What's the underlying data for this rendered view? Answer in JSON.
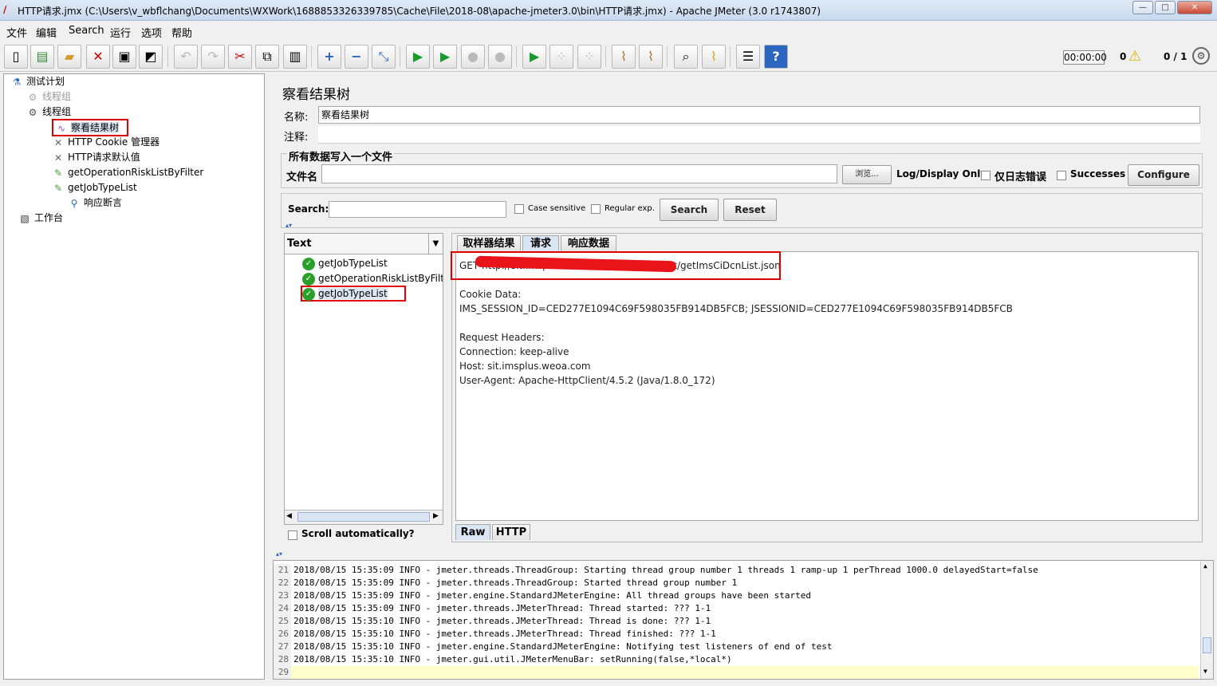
{
  "window": {
    "title": "HTTP请求.jmx (C:\\Users\\v_wbflchang\\Documents\\WXWork\\1688853326339785\\Cache\\File\\2018-08\\apache-jmeter3.0\\bin\\HTTP请求.jmx) - Apache JMeter (3.0 r1743807)",
    "min": "—",
    "max": "□",
    "close": "✕"
  },
  "menu": [
    "文件",
    "编辑",
    "Search",
    "运行",
    "选项",
    "帮助"
  ],
  "toolbar": {
    "timer": "00:00:00",
    "warnings": "0",
    "threads": "0 / 1"
  },
  "tree": {
    "items": [
      {
        "label": "测试计划",
        "icon": "test-plan-icon"
      },
      {
        "label": "线程组",
        "icon": "gear-icon"
      },
      {
        "label": "线程组",
        "icon": "gear-icon"
      },
      {
        "label": "察看结果树",
        "icon": "chart-icon"
      },
      {
        "label": "HTTP Cookie 管理器",
        "icon": "wrench-icon"
      },
      {
        "label": "HTTP请求默认值",
        "icon": "wrench-icon"
      },
      {
        "label": "getOperationRiskListByFilter",
        "icon": "pencil-icon"
      },
      {
        "label": "getJobTypeList",
        "icon": "pencil-icon"
      },
      {
        "label": "响应断言",
        "icon": "magnifier-icon"
      },
      {
        "label": "工作台",
        "icon": "workbench-icon"
      }
    ]
  },
  "panel": {
    "title": "察看结果树",
    "name_label": "名称:",
    "name_value": "察看结果树",
    "comment_label": "注释:",
    "comment_value": "",
    "file_group": "所有数据写入一个文件",
    "file_label": "文件名",
    "file_value": "",
    "browse": "浏览...",
    "log_display": "Log/Display Only:",
    "errors_only": "仅日志错误",
    "successes": "Successes",
    "configure": "Configure",
    "search_label": "Search:",
    "search_value": "",
    "case_sensitive": "Case sensitive",
    "regular_exp": "Regular exp.",
    "search_btn": "Search",
    "reset_btn": "Reset",
    "renderer": "Text",
    "results": [
      "getJobTypeList",
      "getOperationRiskListByFilter",
      "getJobTypeList"
    ],
    "scroll_auto": "Scroll automatically?",
    "tabs": [
      "取样器结果",
      "请求",
      "响应数据"
    ],
    "request_lines": [
      "GET http://sit.imsplus.weoa.com/ims_ci/ci_list/getImsCiDcnList.json",
      "",
      "Cookie Data:",
      "IMS_SESSION_ID=CED277E1094C69F598035FB914DB5FCB; JSESSIONID=CED277E1094C69F598035FB914DB5FCB",
      "",
      "Request Headers:",
      "Connection: keep-alive",
      "Host: sit.imsplus.weoa.com",
      "User-Agent: Apache-HttpClient/4.5.2 (Java/1.8.0_172)"
    ],
    "bottom_tabs": [
      "Raw",
      "HTTP"
    ]
  },
  "log": [
    {
      "n": "21",
      "t": "2018/08/15 15:35:09 INFO  - jmeter.threads.ThreadGroup: Starting thread group number 1 threads 1 ramp-up 1 perThread 1000.0 delayedStart=false"
    },
    {
      "n": "22",
      "t": "2018/08/15 15:35:09 INFO  - jmeter.threads.ThreadGroup: Started thread group number 1"
    },
    {
      "n": "23",
      "t": "2018/08/15 15:35:09 INFO  - jmeter.engine.StandardJMeterEngine: All thread groups have been started"
    },
    {
      "n": "24",
      "t": "2018/08/15 15:35:09 INFO  - jmeter.threads.JMeterThread: Thread started: ??? 1-1"
    },
    {
      "n": "25",
      "t": "2018/08/15 15:35:10 INFO  - jmeter.threads.JMeterThread: Thread is done: ??? 1-1"
    },
    {
      "n": "26",
      "t": "2018/08/15 15:35:10 INFO  - jmeter.threads.JMeterThread: Thread finished: ??? 1-1"
    },
    {
      "n": "27",
      "t": "2018/08/15 15:35:10 INFO  - jmeter.engine.StandardJMeterEngine: Notifying test listeners of end of test"
    },
    {
      "n": "28",
      "t": "2018/08/15 15:35:10 INFO  - jmeter.gui.util.JMeterMenuBar: setRunning(false,*local*)"
    },
    {
      "n": "29",
      "t": ""
    }
  ],
  "colors": {
    "accent": "#3a7bd5",
    "highlight": "#e00000",
    "log_current": "#ffffcc"
  }
}
